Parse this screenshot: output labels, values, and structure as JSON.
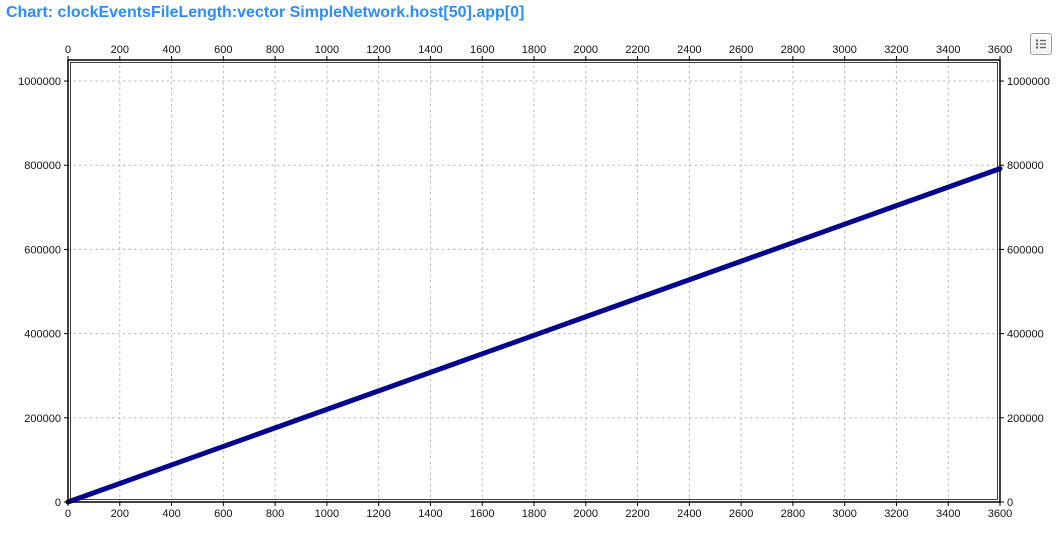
{
  "chart_data": {
    "type": "line",
    "title": "Chart: clockEventsFileLength:vector SimpleNetwork.host[50].app[0]",
    "xlabel": "",
    "ylabel": "",
    "xlim": [
      0,
      3600
    ],
    "ylim": [
      0,
      1050000
    ],
    "x_ticks": [
      0,
      200,
      400,
      600,
      800,
      1000,
      1200,
      1400,
      1600,
      1800,
      2000,
      2200,
      2400,
      2600,
      2800,
      3000,
      3200,
      3400,
      3600
    ],
    "y_ticks": [
      0,
      200000,
      400000,
      600000,
      800000,
      1000000
    ],
    "series": [
      {
        "name": "clockEventsFileLength:vector SimpleNetwork.host[50].app[0]",
        "color": "#04048f",
        "x": [
          0,
          200,
          400,
          600,
          800,
          1000,
          1200,
          1400,
          1600,
          1800,
          2000,
          2200,
          2400,
          2600,
          2800,
          3000,
          3200,
          3400,
          3600
        ],
        "values": [
          0,
          44000,
          88000,
          132000,
          176000,
          220000,
          264000,
          308000,
          352000,
          396000,
          440000,
          484000,
          528000,
          572000,
          616000,
          660000,
          704000,
          748000,
          792000
        ]
      }
    ]
  },
  "ui": {
    "legend_button": "legend-button"
  }
}
